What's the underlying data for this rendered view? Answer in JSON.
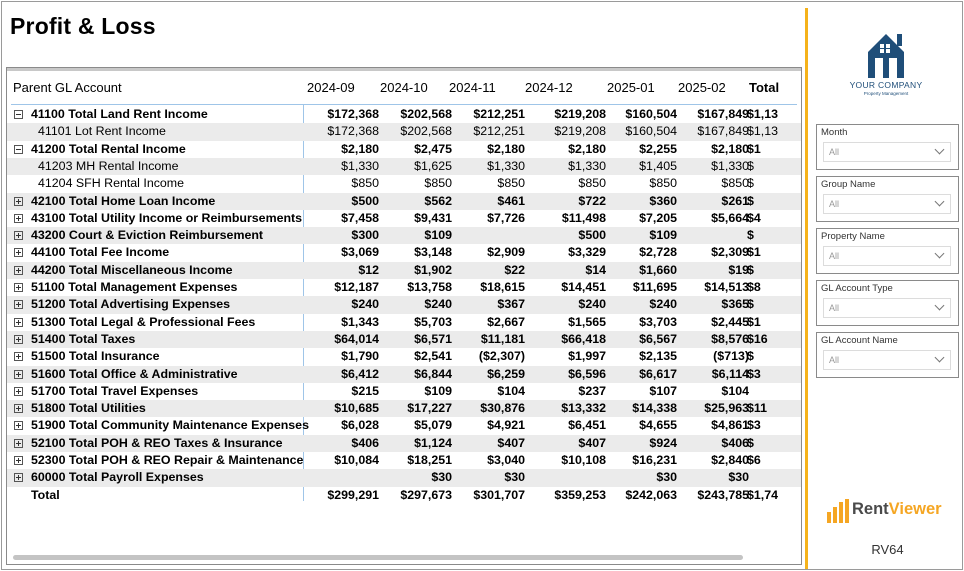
{
  "page": {
    "title": "Profit & Loss"
  },
  "matrix": {
    "row_header": "Parent GL Account",
    "columns": [
      "2024-09",
      "2024-10",
      "2024-11",
      "2024-12",
      "2025-01",
      "2025-02",
      "Total"
    ],
    "rows": [
      {
        "label": "41100 Total Land Rent Income",
        "toggle": "minus",
        "level": 0,
        "bold": true,
        "shade": false,
        "values": [
          "$172,368",
          "$202,568",
          "$212,251",
          "$219,208",
          "$160,504",
          "$167,849",
          "$1,13"
        ]
      },
      {
        "label": "41101 Lot Rent Income",
        "toggle": "",
        "level": 1,
        "bold": false,
        "shade": true,
        "values": [
          "$172,368",
          "$202,568",
          "$212,251",
          "$219,208",
          "$160,504",
          "$167,849",
          "$1,13"
        ]
      },
      {
        "label": "41200 Total Rental Income",
        "toggle": "minus",
        "level": 0,
        "bold": true,
        "shade": false,
        "values": [
          "$2,180",
          "$2,475",
          "$2,180",
          "$2,180",
          "$2,255",
          "$2,180",
          "$1"
        ]
      },
      {
        "label": "41203 MH Rental Income",
        "toggle": "",
        "level": 1,
        "bold": false,
        "shade": true,
        "values": [
          "$1,330",
          "$1,625",
          "$1,330",
          "$1,330",
          "$1,405",
          "$1,330",
          "$"
        ]
      },
      {
        "label": "41204 SFH Rental Income",
        "toggle": "",
        "level": 1,
        "bold": false,
        "shade": false,
        "values": [
          "$850",
          "$850",
          "$850",
          "$850",
          "$850",
          "$850",
          "$"
        ]
      },
      {
        "label": "42100 Total Home Loan Income",
        "toggle": "plus",
        "level": 0,
        "bold": true,
        "shade": true,
        "values": [
          "$500",
          "$562",
          "$461",
          "$722",
          "$360",
          "$261",
          "$"
        ]
      },
      {
        "label": "43100 Total Utility Income or Reimbursements",
        "toggle": "plus",
        "level": 0,
        "bold": true,
        "shade": false,
        "values": [
          "$7,458",
          "$9,431",
          "$7,726",
          "$11,498",
          "$7,205",
          "$5,664",
          "$4"
        ]
      },
      {
        "label": "43200 Court & Eviction Reimbursement",
        "toggle": "plus",
        "level": 0,
        "bold": true,
        "shade": true,
        "values": [
          "$300",
          "$109",
          "",
          "$500",
          "$109",
          "",
          "$"
        ]
      },
      {
        "label": "44100 Total Fee Income",
        "toggle": "plus",
        "level": 0,
        "bold": true,
        "shade": false,
        "values": [
          "$3,069",
          "$3,148",
          "$2,909",
          "$3,329",
          "$2,728",
          "$2,309",
          "$1"
        ]
      },
      {
        "label": "44200 Total Miscellaneous Income",
        "toggle": "plus",
        "level": 0,
        "bold": true,
        "shade": true,
        "values": [
          "$12",
          "$1,902",
          "$22",
          "$14",
          "$1,660",
          "$19",
          "$"
        ]
      },
      {
        "label": "51100 Total Management Expenses",
        "toggle": "plus",
        "level": 0,
        "bold": true,
        "shade": false,
        "values": [
          "$12,187",
          "$13,758",
          "$18,615",
          "$14,451",
          "$11,695",
          "$14,513",
          "$8"
        ]
      },
      {
        "label": "51200 Total Advertising Expenses",
        "toggle": "plus",
        "level": 0,
        "bold": true,
        "shade": true,
        "values": [
          "$240",
          "$240",
          "$367",
          "$240",
          "$240",
          "$365",
          "$"
        ]
      },
      {
        "label": "51300 Total Legal & Professional Fees",
        "toggle": "plus",
        "level": 0,
        "bold": true,
        "shade": false,
        "values": [
          "$1,343",
          "$5,703",
          "$2,667",
          "$1,565",
          "$3,703",
          "$2,445",
          "$1"
        ]
      },
      {
        "label": "51400 Total Taxes",
        "toggle": "plus",
        "level": 0,
        "bold": true,
        "shade": true,
        "values": [
          "$64,014",
          "$6,571",
          "$11,181",
          "$66,418",
          "$6,567",
          "$8,576",
          "$16"
        ]
      },
      {
        "label": "51500 Total Insurance",
        "toggle": "plus",
        "level": 0,
        "bold": true,
        "shade": false,
        "values": [
          "$1,790",
          "$2,541",
          "($2,307)",
          "$1,997",
          "$2,135",
          "($713)",
          "$"
        ]
      },
      {
        "label": "51600 Total Office & Administrative",
        "toggle": "plus",
        "level": 0,
        "bold": true,
        "shade": true,
        "values": [
          "$6,412",
          "$6,844",
          "$6,259",
          "$6,596",
          "$6,617",
          "$6,114",
          "$3"
        ]
      },
      {
        "label": "51700 Total Travel Expenses",
        "toggle": "plus",
        "level": 0,
        "bold": true,
        "shade": false,
        "values": [
          "$215",
          "$109",
          "$104",
          "$237",
          "$107",
          "$104",
          ""
        ]
      },
      {
        "label": "51800 Total Utilities",
        "toggle": "plus",
        "level": 0,
        "bold": true,
        "shade": true,
        "values": [
          "$10,685",
          "$17,227",
          "$30,876",
          "$13,332",
          "$14,338",
          "$25,963",
          "$11"
        ]
      },
      {
        "label": "51900 Total Community Maintenance Expenses",
        "toggle": "plus",
        "level": 0,
        "bold": true,
        "shade": false,
        "values": [
          "$6,028",
          "$5,079",
          "$4,921",
          "$6,451",
          "$4,655",
          "$4,861",
          "$3"
        ]
      },
      {
        "label": "52100 Total POH & REO Taxes & Insurance",
        "toggle": "plus",
        "level": 0,
        "bold": true,
        "shade": true,
        "values": [
          "$406",
          "$1,124",
          "$407",
          "$407",
          "$924",
          "$406",
          "$"
        ]
      },
      {
        "label": "52300 Total POH & REO Repair & Maintenance",
        "toggle": "plus",
        "level": 0,
        "bold": true,
        "shade": false,
        "values": [
          "$10,084",
          "$18,251",
          "$3,040",
          "$10,108",
          "$16,231",
          "$2,840",
          "$6"
        ]
      },
      {
        "label": "60000 Total Payroll Expenses",
        "toggle": "plus",
        "level": 0,
        "bold": true,
        "shade": true,
        "values": [
          "",
          "$30",
          "$30",
          "",
          "$30",
          "$30",
          ""
        ]
      },
      {
        "label": "Total",
        "toggle": "",
        "level": 0,
        "bold": true,
        "shade": false,
        "values": [
          "$299,291",
          "$297,673",
          "$301,707",
          "$359,253",
          "$242,063",
          "$243,785",
          "$1,74"
        ]
      }
    ]
  },
  "brand": {
    "company": "YOUR COMPANY",
    "tagline": "Property Management",
    "primary_color": "#1f4e79"
  },
  "slicers": [
    {
      "title": "Month",
      "value": "All"
    },
    {
      "title": "Group Name",
      "value": "All"
    },
    {
      "title": "Property Name",
      "value": "All"
    },
    {
      "title": "GL Account Type",
      "value": "All"
    },
    {
      "title": "GL Account Name",
      "value": "All"
    }
  ],
  "footer": {
    "product_a": "Rent",
    "product_b": "Viewer",
    "report_code": "RV64",
    "accent_color": "#f5a623"
  }
}
